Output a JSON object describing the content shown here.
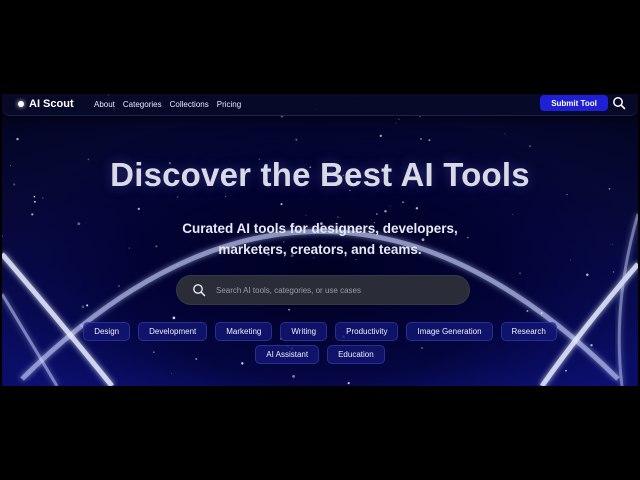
{
  "brand": {
    "name": "AI Scout"
  },
  "nav": {
    "links": [
      "About",
      "Categories",
      "Collections",
      "Pricing"
    ],
    "submit_label": "Submit Tool"
  },
  "hero": {
    "title": "Discover the Best AI Tools",
    "subtitle": "Curated AI tools for designers, developers, marketers, creators, and teams."
  },
  "search": {
    "placeholder": "Search AI tools, categories, or use cases",
    "value": ""
  },
  "categories": {
    "row1": [
      "Design",
      "Development",
      "Marketing",
      "Writing",
      "Productivity",
      "Image Generation",
      "Research"
    ],
    "row2": [
      "AI Assistant",
      "Education"
    ]
  },
  "icons": {
    "brand": "logo-dot-icon",
    "nav_search": "search-icon",
    "search_field": "search-icon"
  },
  "colors": {
    "page_background": "#000000",
    "hero_blue": "#1a22b8",
    "accent_button": "#1f1fd4",
    "search_bg": "#2a2c37",
    "chip_bg": "#14187a"
  }
}
